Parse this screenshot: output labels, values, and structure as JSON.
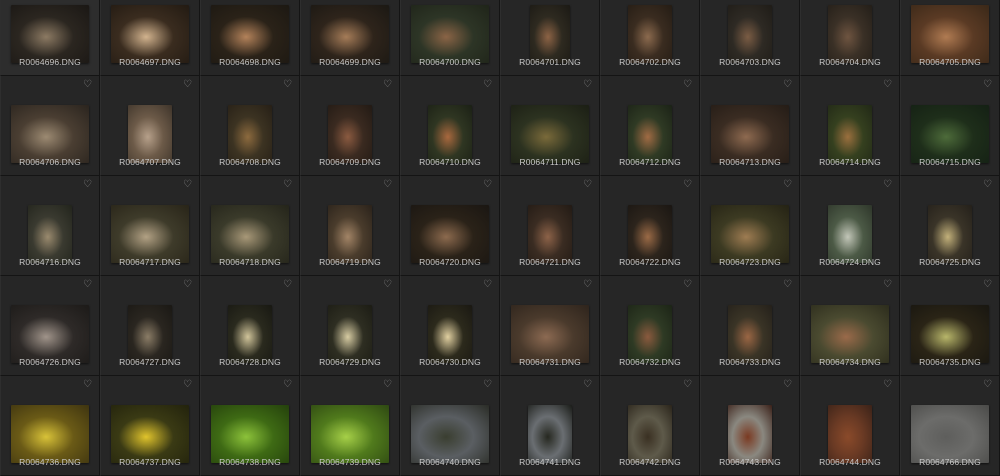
{
  "grid": {
    "favorite_icon": "heart-outline-icon",
    "items": [
      {
        "file": "R0064696.DNG",
        "orient": "landscape",
        "c1": "#2b2620",
        "c2": "#8c7a63",
        "c3": "#1a1714"
      },
      {
        "file": "R0064697.DNG",
        "orient": "landscape",
        "c1": "#3a2c1f",
        "c2": "#d2b38e",
        "c3": "#221a12"
      },
      {
        "file": "R0064698.DNG",
        "orient": "landscape",
        "c1": "#2a2218",
        "c2": "#b3825a",
        "c3": "#1c1812"
      },
      {
        "file": "R0064699.DNG",
        "orient": "landscape",
        "c1": "#2e241b",
        "c2": "#a57c58",
        "c3": "#1b1813"
      },
      {
        "file": "R0064700.DNG",
        "orient": "landscape",
        "c1": "#2d3526",
        "c2": "#8a6446",
        "c3": "#1f2419"
      },
      {
        "file": "R0064701.DNG",
        "orient": "portrait2",
        "c1": "#2e2a20",
        "c2": "#8c6345",
        "c3": "#1b1914"
      },
      {
        "file": "R0064702.DNG",
        "orient": "portrait",
        "c1": "#3a2c20",
        "c2": "#8b6a4e",
        "c3": "#241c14"
      },
      {
        "file": "R0064703.DNG",
        "orient": "portrait",
        "c1": "#2e2a24",
        "c2": "#7a5c44",
        "c3": "#1f1c17"
      },
      {
        "file": "R0064704.DNG",
        "orient": "portrait",
        "c1": "#3a3026",
        "c2": "#6e5440",
        "c3": "#231e18"
      },
      {
        "file": "R0064705.DNG",
        "orient": "landscape",
        "c1": "#5a3a24",
        "c2": "#b07b52",
        "c3": "#3a2818"
      },
      {
        "file": "R0064706.DNG",
        "orient": "landscape",
        "c1": "#4a3e32",
        "c2": "#9c8a72",
        "c3": "#2a241e"
      },
      {
        "file": "R0064707.DNG",
        "orient": "portrait",
        "c1": "#6c5a48",
        "c2": "#b6a08a",
        "c3": "#3e342a"
      },
      {
        "file": "R0064708.DNG",
        "orient": "portrait",
        "c1": "#3c3322",
        "c2": "#8c6a3e",
        "c3": "#261f16"
      },
      {
        "file": "R0064709.DNG",
        "orient": "portrait",
        "c1": "#3a2a20",
        "c2": "#8a5a40",
        "c3": "#221a14"
      },
      {
        "file": "R0064710.DNG",
        "orient": "portrait",
        "c1": "#2f3622",
        "c2": "#a8683e",
        "c3": "#1b2015"
      },
      {
        "file": "R0064711.DNG",
        "orient": "landscape",
        "c1": "#2c3220",
        "c2": "#7a6a3a",
        "c3": "#1b1e14"
      },
      {
        "file": "R0064712.DNG",
        "orient": "portrait",
        "c1": "#2f3a24",
        "c2": "#a06b44",
        "c3": "#1b2216"
      },
      {
        "file": "R0064713.DNG",
        "orient": "landscape",
        "c1": "#3a2c22",
        "c2": "#8e6a50",
        "c3": "#241c16"
      },
      {
        "file": "R0064714.DNG",
        "orient": "portrait",
        "c1": "#35401f",
        "c2": "#9a6f3e",
        "c3": "#212816"
      },
      {
        "file": "R0064715.DNG",
        "orient": "landscape",
        "c1": "#1e2e1a",
        "c2": "#4d6b3a",
        "c3": "#142014"
      },
      {
        "file": "R0064716.DNG",
        "orient": "portrait",
        "c1": "#3a3a30",
        "c2": "#9a8a6e",
        "c3": "#22241c"
      },
      {
        "file": "R0064717.DNG",
        "orient": "landscape",
        "c1": "#3e3b2a",
        "c2": "#b2a184",
        "c3": "#282418"
      },
      {
        "file": "R0064718.DNG",
        "orient": "landscape",
        "c1": "#3a3a2a",
        "c2": "#a89878",
        "c3": "#24241a"
      },
      {
        "file": "R0064719.DNG",
        "orient": "portrait",
        "c1": "#4a3c2c",
        "c2": "#a28466",
        "c3": "#2a221a"
      },
      {
        "file": "R0064720.DNG",
        "orient": "landscape",
        "c1": "#2a2218",
        "c2": "#8c6a4e",
        "c3": "#1a1612"
      },
      {
        "file": "R0064721.DNG",
        "orient": "portrait",
        "c1": "#3a2c22",
        "c2": "#8c6248",
        "c3": "#221a14"
      },
      {
        "file": "R0064722.DNG",
        "orient": "portrait",
        "c1": "#2c241c",
        "c2": "#9a6a46",
        "c3": "#1a1612"
      },
      {
        "file": "R0064723.DNG",
        "orient": "landscape",
        "c1": "#3c3a22",
        "c2": "#9e7c52",
        "c3": "#242214"
      },
      {
        "file": "R0064724.DNG",
        "orient": "portrait",
        "c1": "#4c5a46",
        "c2": "#c2c6b8",
        "c3": "#2e362a"
      },
      {
        "file": "R0064725.DNG",
        "orient": "portrait",
        "c1": "#3a3428",
        "c2": "#c2b07a",
        "c3": "#24201a"
      },
      {
        "file": "R0064726.DNG",
        "orient": "landscape",
        "c1": "#2e2a28",
        "c2": "#a0948a",
        "c3": "#1c1a18"
      },
      {
        "file": "R0064727.DNG",
        "orient": "portrait",
        "c1": "#2a2620",
        "c2": "#8a7c66",
        "c3": "#1a1814"
      },
      {
        "file": "R0064728.DNG",
        "orient": "portrait",
        "c1": "#2a2a1e",
        "c2": "#d0c49a",
        "c3": "#181812"
      },
      {
        "file": "R0064729.DNG",
        "orient": "portrait",
        "c1": "#2e2e22",
        "c2": "#d6cba2",
        "c3": "#1c1c14"
      },
      {
        "file": "R0064730.DNG",
        "orient": "portrait",
        "c1": "#2c2a1c",
        "c2": "#e0cfa0",
        "c3": "#1a1812"
      },
      {
        "file": "R0064731.DNG",
        "orient": "landscape",
        "c1": "#4a3a2c",
        "c2": "#8c6a52",
        "c3": "#2e241c"
      },
      {
        "file": "R0064732.DNG",
        "orient": "portrait",
        "c1": "#2e3a24",
        "c2": "#8a5a3e",
        "c3": "#1c2416"
      },
      {
        "file": "R0064733.DNG",
        "orient": "portrait",
        "c1": "#3a3426",
        "c2": "#9a6644",
        "c3": "#24201a"
      },
      {
        "file": "R0064734.DNG",
        "orient": "landscape",
        "c1": "#4a4a30",
        "c2": "#9a6a4a",
        "c3": "#2c2c1c"
      },
      {
        "file": "R0064735.DNG",
        "orient": "landscape",
        "c1": "#2a2416",
        "c2": "#b8b66a",
        "c3": "#181610"
      },
      {
        "file": "R0064736.DNG",
        "orient": "landscape",
        "c1": "#6a5a16",
        "c2": "#d8c238",
        "c3": "#3e3410"
      },
      {
        "file": "R0064737.DNG",
        "orient": "landscape",
        "c1": "#3a3a14",
        "c2": "#e0c42c",
        "c3": "#22220c"
      },
      {
        "file": "R0064738.DNG",
        "orient": "landscape",
        "c1": "#3e6a14",
        "c2": "#8cc23a",
        "c3": "#24400c"
      },
      {
        "file": "R0064739.DNG",
        "orient": "landscape",
        "c1": "#507a1c",
        "c2": "#a6d048",
        "c3": "#2e4812"
      },
      {
        "file": "R0064740.DNG",
        "orient": "landscape",
        "c1": "#5a5e62",
        "c2": "#3a3e30",
        "c3": "#2a2c26"
      },
      {
        "file": "R0064741.DNG",
        "orient": "portrait",
        "c1": "#6a6e72",
        "c2": "#262820",
        "c3": "#1a1c18"
      },
      {
        "file": "R0064742.DNG",
        "orient": "portrait",
        "c1": "#5e5a4a",
        "c2": "#3a3022",
        "c3": "#2a241a"
      },
      {
        "file": "R0064743.DNG",
        "orient": "portrait",
        "c1": "#8a8880",
        "c2": "#7a3a22",
        "c3": "#3a2018"
      },
      {
        "file": "R0064744.DNG",
        "orient": "portrait",
        "c1": "#6a3a24",
        "c2": "#8a4a2a",
        "c3": "#3a2218"
      },
      {
        "file": "R0064766.DNG",
        "orient": "landscape",
        "c1": "#6c6c6a",
        "c2": "#5e5e5c",
        "c3": "#4a4a48"
      }
    ]
  }
}
